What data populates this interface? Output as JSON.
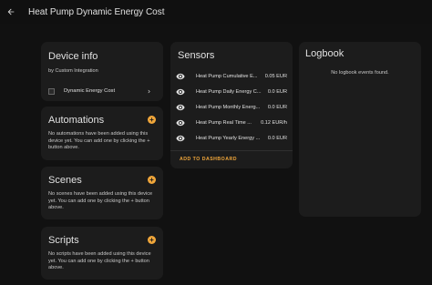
{
  "header": {
    "title": "Heat Pump Dynamic Energy Cost"
  },
  "device_info": {
    "title": "Device info",
    "by": "by Custom Integration",
    "device_name": "Dynamic Energy Cost"
  },
  "automations": {
    "title": "Automations",
    "description": "No automations have been added using this device yet. You can add one by clicking the + button above."
  },
  "scenes": {
    "title": "Scenes",
    "description": "No scenes have been added using this device yet. You can add one by clicking the + button above."
  },
  "scripts": {
    "title": "Scripts",
    "description": "No scripts have been added using this device yet. You can add one by clicking the + button above."
  },
  "sensors": {
    "title": "Sensors",
    "items": [
      {
        "name": "Heat Pump Cumulative E...",
        "value": "0.05 EUR"
      },
      {
        "name": "Heat Pump Daily Energy C...",
        "value": "0.0 EUR"
      },
      {
        "name": "Heat Pump Monthly Energ...",
        "value": "0.0 EUR"
      },
      {
        "name": "Heat Pump Real Time ...",
        "value": "0.12 EUR/h"
      },
      {
        "name": "Heat Pump Yearly Energy ...",
        "value": "0.0 EUR"
      }
    ],
    "add_label": "ADD TO DASHBOARD"
  },
  "logbook": {
    "title": "Logbook",
    "empty": "No logbook events found."
  },
  "colors": {
    "accent": "#f0a63a",
    "card": "#1c1c1c",
    "background": "#111111"
  }
}
